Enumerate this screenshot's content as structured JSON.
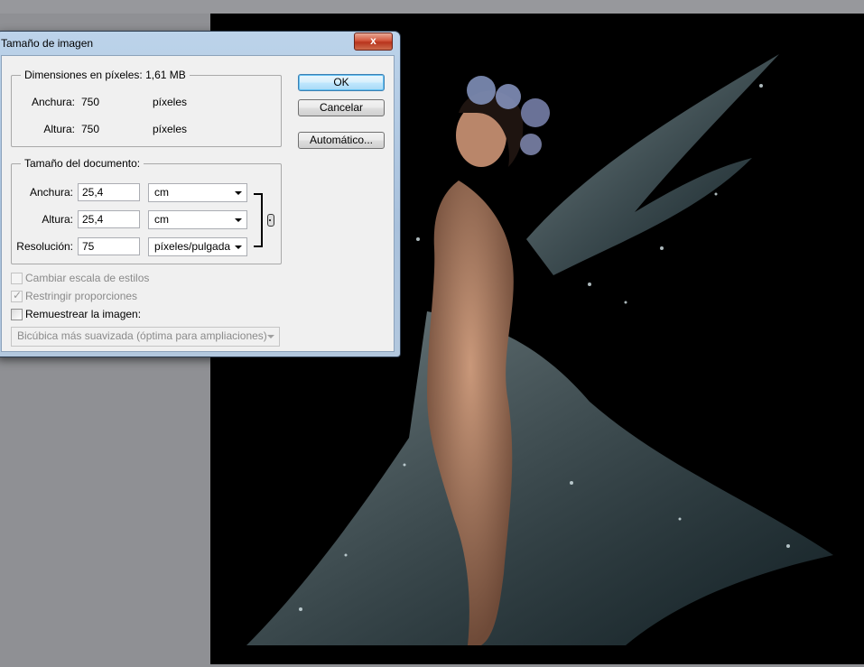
{
  "dialog": {
    "title": "Tamaño de imagen",
    "close_label": "x",
    "pixel_dimensions": {
      "label": "Dimensiones en píxeles:",
      "size": "1,61 MB",
      "width_label": "Anchura:",
      "width_value": "750",
      "width_unit": "píxeles",
      "height_label": "Altura:",
      "height_value": "750",
      "height_unit": "píxeles"
    },
    "document_size": {
      "label": "Tamaño del documento:",
      "width_label": "Anchura:",
      "width_value": "25,4",
      "width_unit": "cm",
      "height_label": "Altura:",
      "height_value": "25,4",
      "height_unit": "cm",
      "resolution_label": "Resolución:",
      "resolution_value": "75",
      "resolution_unit": "píxeles/pulgada"
    },
    "buttons": {
      "ok": "OK",
      "cancel": "Cancelar",
      "auto": "Automático..."
    },
    "options": {
      "scale_styles": "Cambiar escala de estilos",
      "constrain": "Restringir proporciones",
      "resample": "Remuestrear la imagen:",
      "resample_method": "Bicúbica más suavizada (óptima para ampliaciones)"
    }
  },
  "colors": {
    "canvas_bg": "#000000",
    "workspace_bg": "#8f9094",
    "dialog_face": "#f0f0f0",
    "close_button": "#c8482e"
  },
  "icons": [
    "close-icon",
    "chain-link-icon",
    "dropdown-arrow-icon",
    "checkmark-icon"
  ]
}
